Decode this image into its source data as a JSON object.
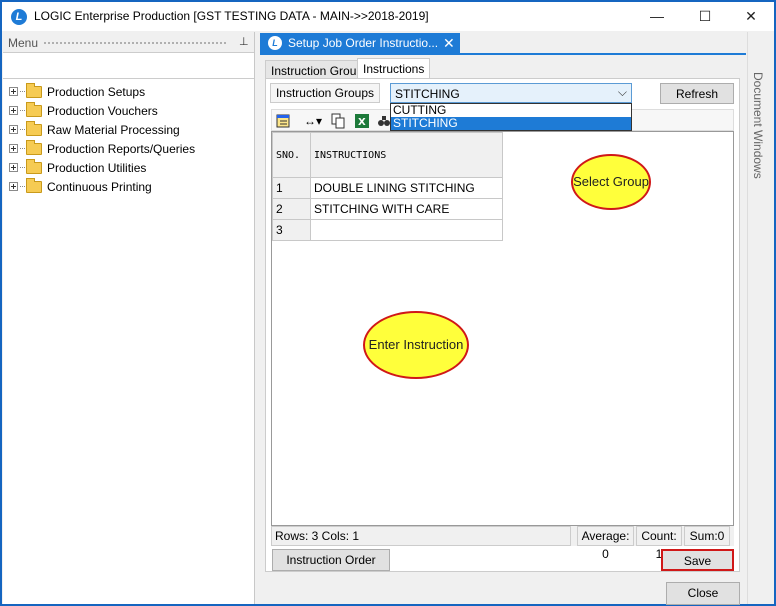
{
  "window": {
    "title": "LOGIC Enterprise Production  [GST TESTING DATA - MAIN->>2018-2019]",
    "controls": {
      "minimize": "—",
      "maximize": "☐",
      "close": "✕"
    }
  },
  "menu": {
    "header": "Menu",
    "pin": "⊥",
    "items": [
      {
        "label": "Production Setups"
      },
      {
        "label": "Production Vouchers"
      },
      {
        "label": "Raw Material Processing"
      },
      {
        "label": "Production Reports/Queries"
      },
      {
        "label": "Production Utilities"
      },
      {
        "label": "Continuous Printing"
      }
    ]
  },
  "document_tab": {
    "label": "Setup Job Order Instructio...",
    "close": "✕"
  },
  "side_panel": {
    "label": "Document Windows"
  },
  "tabs": [
    {
      "label": "Instruction Group"
    },
    {
      "label": "Instructions"
    }
  ],
  "instruction_groups": {
    "label": "Instruction Groups",
    "selected": "STITCHING",
    "options": [
      "CUTTING",
      "STITCHING"
    ]
  },
  "refresh_button": "Refresh",
  "grid": {
    "headers": [
      "SNO.",
      "INSTRUCTIONS"
    ],
    "rows": [
      {
        "sno": "1",
        "instruction": "DOUBLE LINING STITCHING"
      },
      {
        "sno": "2",
        "instruction": "STITCHING WITH CARE"
      },
      {
        "sno": "3",
        "instruction": ""
      }
    ]
  },
  "callouts": {
    "select_group": "Select Group",
    "enter_instruction": "Enter Instruction"
  },
  "status": {
    "rows_cols": "Rows: 3  Cols: 1",
    "average": "Average: 0",
    "count": "Count: 1",
    "sum": "Sum:0"
  },
  "buttons": {
    "instruction_order": "Instruction Order",
    "save": "Save",
    "close": "Close"
  },
  "colors": {
    "accent": "#1e7bd6",
    "callout_fill": "#ffff3b",
    "callout_border": "#d01818"
  }
}
